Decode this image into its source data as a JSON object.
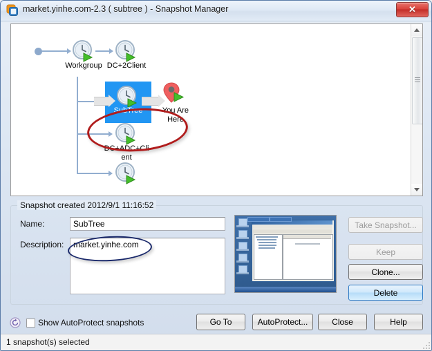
{
  "window": {
    "title": "market.yinhe.com-2.3 ( subtree )  - Snapshot Manager",
    "app_icon": "vmware-icon",
    "close_label": "✕"
  },
  "tree": {
    "nodes": [
      {
        "id": "workgroup",
        "label": "Workgroup",
        "icon": "snapshot-clock-icon"
      },
      {
        "id": "dc2client",
        "label": "DC+2Client",
        "icon": "snapshot-clock-icon"
      },
      {
        "id": "subtree",
        "label": "SubTree",
        "icon": "snapshot-clock-icon",
        "selected": true
      },
      {
        "id": "youarehere",
        "label": "You Are\nHere",
        "icon": "you-are-here-pin-icon"
      },
      {
        "id": "dcadcclient",
        "label": "DC+ADC+Cli\nent",
        "icon": "snapshot-clock-icon"
      },
      {
        "id": "unnamed",
        "label": "",
        "icon": "snapshot-clock-icon"
      }
    ],
    "scrollbar": {
      "up": "▲",
      "down": "▼"
    }
  },
  "details": {
    "legend": "Snapshot created 2012/9/1 11:16:52",
    "name_label": "Name:",
    "name_value": "SubTree",
    "name_placeholder": "",
    "description_label": "Description:",
    "description_value": "market.yinhe.com",
    "description_placeholder": "",
    "thumbnail_name": "snapshot-preview-thumbnail"
  },
  "actions": {
    "take_snapshot": "Take Snapshot...",
    "keep": "Keep",
    "clone": "Clone...",
    "delete": "Delete"
  },
  "footer": {
    "autoprotect_icon": "autoprotect-icon",
    "show_autoprotect_label": "Show AutoProtect snapshots",
    "show_autoprotect_checked": false,
    "go_to": "Go To",
    "autoprotect": "AutoProtect...",
    "close": "Close",
    "help": "Help"
  },
  "status": {
    "text": "1 snapshot(s) selected"
  },
  "colors": {
    "selection_blue": "#2196f3",
    "annotation_red": "#b01c1c",
    "annotation_navy": "#1b2a6b",
    "close_red": "#c32e28",
    "focus_blue": "#2c79c4"
  }
}
